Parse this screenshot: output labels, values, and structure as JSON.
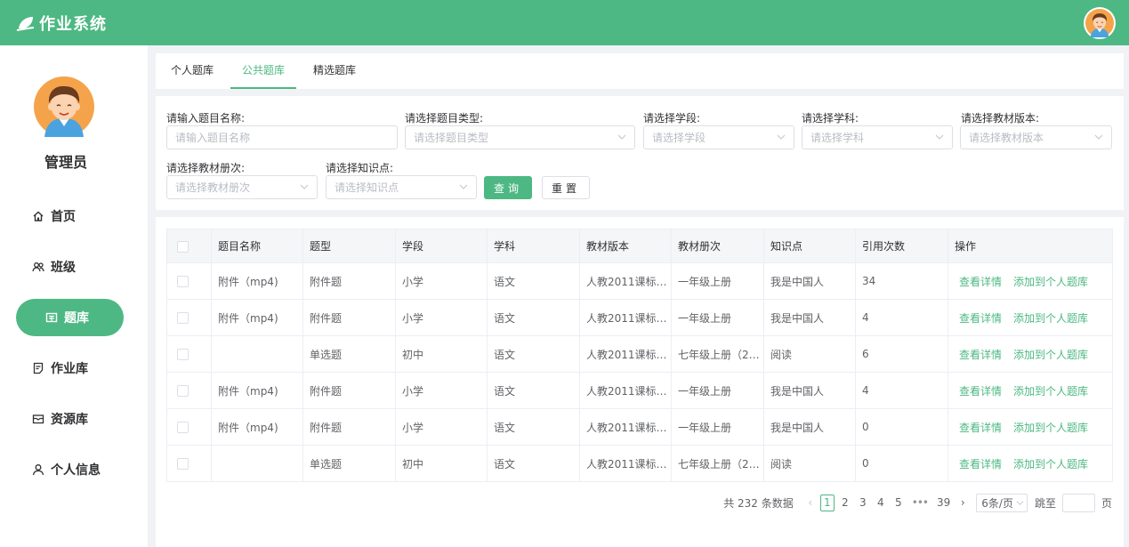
{
  "app": {
    "title": "作业系统"
  },
  "user": {
    "name": "管理员"
  },
  "nav": [
    {
      "label": "首页",
      "icon": "home-icon"
    },
    {
      "label": "班级",
      "icon": "class-group-icon"
    },
    {
      "label": "题库",
      "icon": "question-bank-icon",
      "active": true
    },
    {
      "label": "作业库",
      "icon": "homework-icon"
    },
    {
      "label": "资源库",
      "icon": "resource-icon"
    },
    {
      "label": "个人信息",
      "icon": "user-icon"
    }
  ],
  "tabs": [
    {
      "label": "个人题库"
    },
    {
      "label": "公共题库",
      "active": true
    },
    {
      "label": "精选题库"
    }
  ],
  "filters": {
    "name": {
      "label": "请输入题目名称:",
      "placeholder": "请输入题目名称"
    },
    "type": {
      "label": "请选择题目类型:",
      "placeholder": "请选择题目类型"
    },
    "stage": {
      "label": "请选择学段:",
      "placeholder": "请选择学段"
    },
    "subject": {
      "label": "请选择学科:",
      "placeholder": "请选择学科"
    },
    "edition": {
      "label": "请选择教材版本:",
      "placeholder": "请选择教材版本"
    },
    "volume": {
      "label": "请选择教材册次:",
      "placeholder": "请选择教材册次"
    },
    "point": {
      "label": "请选择知识点:",
      "placeholder": "请选择知识点"
    },
    "query_label": "查询",
    "reset_label": "重置"
  },
  "table": {
    "columns": [
      "题目名称",
      "题型",
      "学段",
      "学科",
      "教材版本",
      "教材册次",
      "知识点",
      "引用次数",
      "操作"
    ],
    "rows": [
      {
        "name": "附件（mp4)",
        "type": "附件题",
        "stage": "小学",
        "subject": "语文",
        "edition": "人教2011课标…",
        "volume": "一年级上册",
        "point": "我是中国人",
        "count": "34"
      },
      {
        "name": "附件（mp4)",
        "type": "附件题",
        "stage": "小学",
        "subject": "语文",
        "edition": "人教2011课标…",
        "volume": "一年级上册",
        "point": "我是中国人",
        "count": "4"
      },
      {
        "name": "",
        "type": "单选题",
        "stage": "初中",
        "subject": "语文",
        "edition": "人教2011课标…",
        "volume": "七年级上册（2…",
        "point": "阅读",
        "count": "6"
      },
      {
        "name": "附件（mp4)",
        "type": "附件题",
        "stage": "小学",
        "subject": "语文",
        "edition": "人教2011课标…",
        "volume": "一年级上册",
        "point": "我是中国人",
        "count": "4"
      },
      {
        "name": "附件（mp4)",
        "type": "附件题",
        "stage": "小学",
        "subject": "语文",
        "edition": "人教2011课标…",
        "volume": "一年级上册",
        "point": "我是中国人",
        "count": "0"
      },
      {
        "name": "",
        "type": "单选题",
        "stage": "初中",
        "subject": "语文",
        "edition": "人教2011课标…",
        "volume": "七年级上册（2…",
        "point": "阅读",
        "count": "0"
      }
    ],
    "action_view": "查看详情",
    "action_add": "添加到个人题库"
  },
  "pagination": {
    "total_text": "共 232 条数据",
    "pages": [
      "1",
      "2",
      "3",
      "4",
      "5"
    ],
    "ellipsis": "•••",
    "last": "39",
    "page_size": "6条/页",
    "jump_label": "跳至",
    "page_suffix": "页",
    "current": "1"
  },
  "colors": {
    "accent": "#4db883",
    "avatar_skin": "#fbd3b0",
    "avatar_hair": "#6b3b1f",
    "avatar_bg": "#f5a34b"
  }
}
